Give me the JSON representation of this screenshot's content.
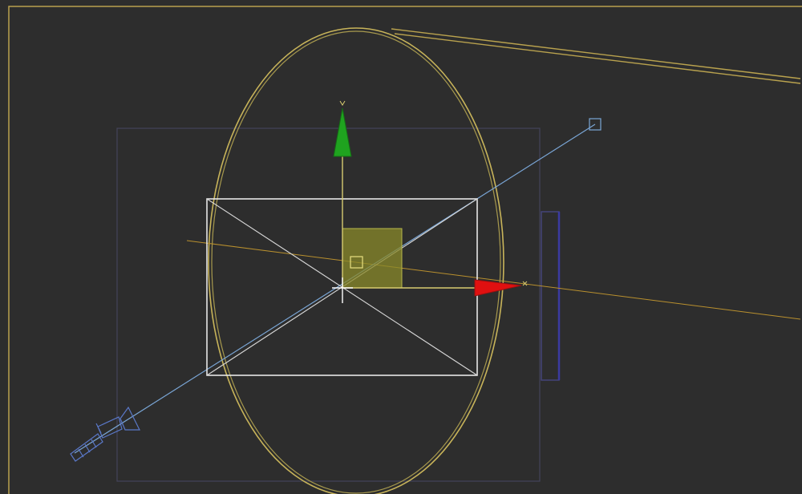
{
  "viewport": {
    "background_color": "#2d2d2d",
    "border_color": "#b9a24e",
    "active": true
  },
  "gizmo": {
    "type": "move-transform-gizmo",
    "x_axis_label": "",
    "y_axis_label": "",
    "x_axis_color": "#e01010",
    "y_axis_color": "#1fa31f",
    "xy_plane_color": "#8a8a2a"
  },
  "objects": {
    "selected_object": "ellipse-shape",
    "selection_color": "#c8b45a",
    "camera_icon_color": "#5a78c8",
    "target_line_color": "#7aa6d6",
    "safe_frame_color": "#e6e6e6",
    "background_plane_color": "#4a4a66"
  }
}
